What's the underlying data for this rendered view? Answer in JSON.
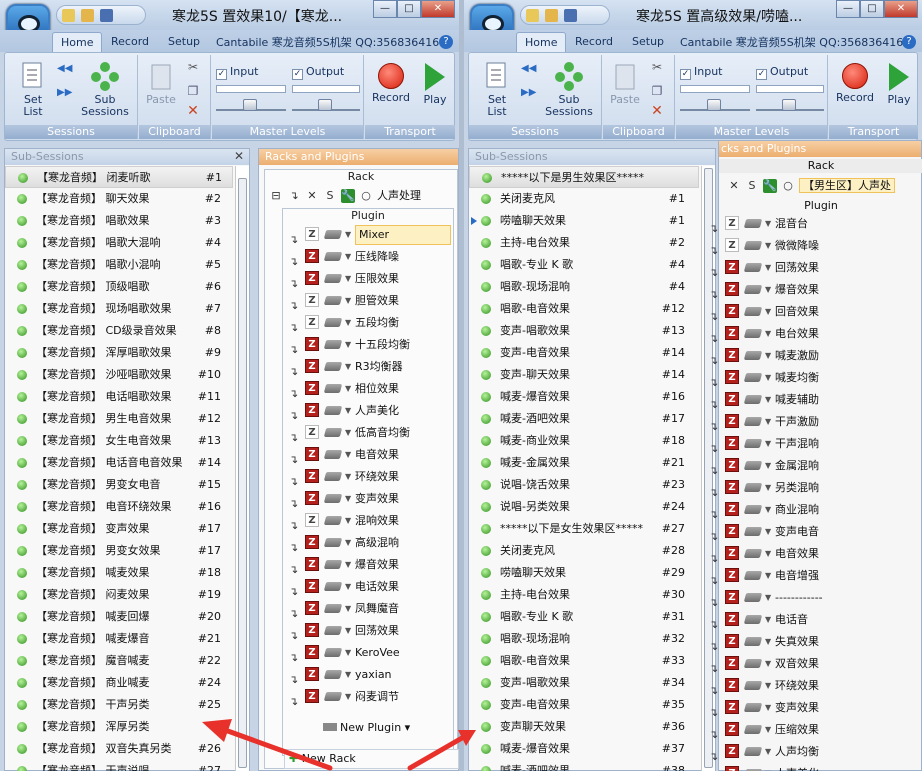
{
  "left_window": {
    "title": "寒龙5S 置效果10/【寒龙...",
    "tabs": [
      "Home",
      "Record",
      "Setup"
    ],
    "rack_name": "Cantabile 寒龙音频5S机架 QQ:356836416",
    "ribbon": {
      "sessions": {
        "label": "Sessions",
        "set_list": "Set\nList",
        "sub_sessions": "Sub\nSessions"
      },
      "clipboard": {
        "label": "Clipboard",
        "paste": "Paste"
      },
      "master_levels": {
        "label": "Master Levels",
        "input": "Input",
        "output": "Output"
      },
      "transport": {
        "label": "Transport",
        "record": "Record",
        "play": "Play"
      }
    },
    "subsessions": {
      "title": "Sub-Sessions",
      "items": [
        {
          "label": "【寒龙音频】 闭麦听歌",
          "num": "#1"
        },
        {
          "label": "【寒龙音频】 聊天效果",
          "num": "#2"
        },
        {
          "label": "【寒龙音频】 唱歌效果",
          "num": "#3"
        },
        {
          "label": "【寒龙音频】 唱歌大混响",
          "num": "#4"
        },
        {
          "label": "【寒龙音频】 唱歌小混响",
          "num": "#5"
        },
        {
          "label": "【寒龙音频】 顶级唱歌",
          "num": "#6"
        },
        {
          "label": "【寒龙音频】 现场唱歌效果",
          "num": "#7"
        },
        {
          "label": "【寒龙音频】 CD级录音效果",
          "num": "#8"
        },
        {
          "label": "【寒龙音频】 浑厚唱歌效果",
          "num": "#9"
        },
        {
          "label": "【寒龙音频】 沙哑唱歌效果",
          "num": "#10"
        },
        {
          "label": "【寒龙音频】 电话唱歌效果",
          "num": "#11"
        },
        {
          "label": "【寒龙音频】 男生电音效果",
          "num": "#12"
        },
        {
          "label": "【寒龙音频】 女生电音效果",
          "num": "#13"
        },
        {
          "label": "【寒龙音频】 电话音电音效果",
          "num": "#14"
        },
        {
          "label": "【寒龙音频】 男变女电音",
          "num": "#15"
        },
        {
          "label": "【寒龙音频】 电音环绕效果",
          "num": "#16"
        },
        {
          "label": "【寒龙音频】 变声效果",
          "num": "#17"
        },
        {
          "label": "【寒龙音频】 男变女效果",
          "num": "#17"
        },
        {
          "label": "【寒龙音频】 喊麦效果",
          "num": "#18"
        },
        {
          "label": "【寒龙音频】 闷麦效果",
          "num": "#19"
        },
        {
          "label": "【寒龙音频】 喊麦回爆",
          "num": "#20"
        },
        {
          "label": "【寒龙音频】 喊麦爆音",
          "num": "#21"
        },
        {
          "label": "【寒龙音频】 魔音喊麦",
          "num": "#22"
        },
        {
          "label": "【寒龙音频】 商业喊麦",
          "num": "#24"
        },
        {
          "label": "【寒龙音频】 干声另类",
          "num": "#25"
        },
        {
          "label": "【寒龙音频】 浑厚另类",
          "num": ""
        },
        {
          "label": "【寒龙音频】 双音失真另类",
          "num": "#26"
        },
        {
          "label": "【寒龙音频】 干声说唱",
          "num": "#27"
        }
      ]
    },
    "racks": {
      "title": "Racks and Plugins",
      "rack_label": "Rack",
      "rack_item": "人声处理",
      "plugin_label": "Plugin",
      "plugins": [
        {
          "name": "Mixer",
          "z": false
        },
        {
          "name": "压线降噪",
          "z": true
        },
        {
          "name": "压限效果",
          "z": true
        },
        {
          "name": "胆管效果",
          "z": false
        },
        {
          "name": "五段均衡",
          "z": false
        },
        {
          "name": "十五段均衡",
          "z": true
        },
        {
          "name": "R3均衡器",
          "z": true
        },
        {
          "name": "相位效果",
          "z": true
        },
        {
          "name": "人声美化",
          "z": true
        },
        {
          "name": "低高音均衡",
          "z": false
        },
        {
          "name": "电音效果",
          "z": true
        },
        {
          "name": "环绕效果",
          "z": true
        },
        {
          "name": "变声效果",
          "z": true
        },
        {
          "name": "混响效果",
          "z": false
        },
        {
          "name": "高级混响",
          "z": true
        },
        {
          "name": "爆音效果",
          "z": true
        },
        {
          "name": "电话效果",
          "z": true
        },
        {
          "name": "凤舞魔音",
          "z": true
        },
        {
          "name": "回荡效果",
          "z": true
        },
        {
          "name": "KeroVee",
          "z": true
        },
        {
          "name": "yaxian",
          "z": true
        },
        {
          "name": "闷麦调节",
          "z": true
        }
      ],
      "new_plugin": "New Plugin",
      "new_rack": "New Rack"
    }
  },
  "right_window": {
    "title": "寒龙5S 置高级效果/唠嗑...",
    "tabs": [
      "Home",
      "Record",
      "Setup"
    ],
    "rack_name": "Cantabile 寒龙音频5S机架 QQ:356836416",
    "ribbon": {
      "sessions": {
        "label": "Sessions",
        "set_list": "Set\nList",
        "sub_sessions": "Sub\nSessions"
      },
      "clipboard": {
        "label": "Clipboard",
        "paste": "Paste"
      },
      "master_levels": {
        "label": "Master Levels",
        "input": "Input",
        "output": "Output"
      },
      "transport": {
        "label": "Transport",
        "record": "Record",
        "play": "Play"
      }
    },
    "subsessions": {
      "title": "Sub-Sessions",
      "items": [
        {
          "label": "*****以下是男生效果区*****",
          "num": ""
        },
        {
          "label": "关闭麦克风",
          "num": "#1"
        },
        {
          "label": "唠嗑聊天效果",
          "num": "#1"
        },
        {
          "label": "主持-电台效果",
          "num": "#2"
        },
        {
          "label": "唱歌-专业 K 歌",
          "num": "#4"
        },
        {
          "label": "唱歌-现场混响",
          "num": "#4"
        },
        {
          "label": "唱歌-电音效果",
          "num": "#12"
        },
        {
          "label": "变声-唱歌效果",
          "num": "#13"
        },
        {
          "label": "变声-电音效果",
          "num": "#14"
        },
        {
          "label": "变声-聊天效果",
          "num": "#14"
        },
        {
          "label": "喊麦-爆音效果",
          "num": "#16"
        },
        {
          "label": "喊麦-酒吧效果",
          "num": "#17"
        },
        {
          "label": "喊麦-商业效果",
          "num": "#18"
        },
        {
          "label": "喊麦-金属效果",
          "num": "#21"
        },
        {
          "label": "说唱-饶舌效果",
          "num": "#23"
        },
        {
          "label": "说唱-另类效果",
          "num": "#24"
        },
        {
          "label": "*****以下是女生效果区*****",
          "num": "#27"
        },
        {
          "label": "关闭麦克风",
          "num": "#28"
        },
        {
          "label": "唠嗑聊天效果",
          "num": "#29"
        },
        {
          "label": "主持-电台效果",
          "num": "#30"
        },
        {
          "label": "唱歌-专业 K 歌",
          "num": "#31"
        },
        {
          "label": "唱歌-现场混响",
          "num": "#32"
        },
        {
          "label": "唱歌-电音效果",
          "num": "#33"
        },
        {
          "label": "变声-唱歌效果",
          "num": "#34"
        },
        {
          "label": "变声-电音效果",
          "num": "#35"
        },
        {
          "label": "变声聊天效果",
          "num": "#36"
        },
        {
          "label": "喊麦-爆音效果",
          "num": "#37"
        },
        {
          "label": "喊麦-酒吧效果",
          "num": "#38"
        }
      ]
    },
    "racks": {
      "title": "cks and Plugins",
      "rack_label": "Rack",
      "rack_item": "【男生区】人声处",
      "plugin_label": "Plugin",
      "plugins": [
        {
          "name": "混音台",
          "z": false
        },
        {
          "name": "微微降噪",
          "z": false
        },
        {
          "name": "回荡效果",
          "z": true
        },
        {
          "name": "爆音效果",
          "z": true
        },
        {
          "name": "回音效果",
          "z": true
        },
        {
          "name": "电台效果",
          "z": true
        },
        {
          "name": "喊麦激励",
          "z": true
        },
        {
          "name": "喊麦均衡",
          "z": true
        },
        {
          "name": "喊麦辅助",
          "z": true
        },
        {
          "name": "干声激励",
          "z": true
        },
        {
          "name": "干声混响",
          "z": true
        },
        {
          "name": "金属混响",
          "z": true
        },
        {
          "name": "另类混响",
          "z": true
        },
        {
          "name": "商业混响",
          "z": true
        },
        {
          "name": "变声电音",
          "z": true
        },
        {
          "name": "电音效果",
          "z": true
        },
        {
          "name": "电音增强",
          "z": true
        },
        {
          "name": "------------",
          "z": true
        },
        {
          "name": "电话音",
          "z": true
        },
        {
          "name": "失真效果",
          "z": true
        },
        {
          "name": "双音效果",
          "z": true
        },
        {
          "name": "环绕效果",
          "z": true
        },
        {
          "name": "变声效果",
          "z": true
        },
        {
          "name": "压缩效果",
          "z": true
        },
        {
          "name": "人声均衡",
          "z": true
        },
        {
          "name": "人声美化",
          "z": true
        }
      ]
    }
  },
  "colors": {
    "annotation_arrow": "#e8312a",
    "panel_orange": "#ecae6f",
    "ribbon_blue": "#95aecf"
  }
}
